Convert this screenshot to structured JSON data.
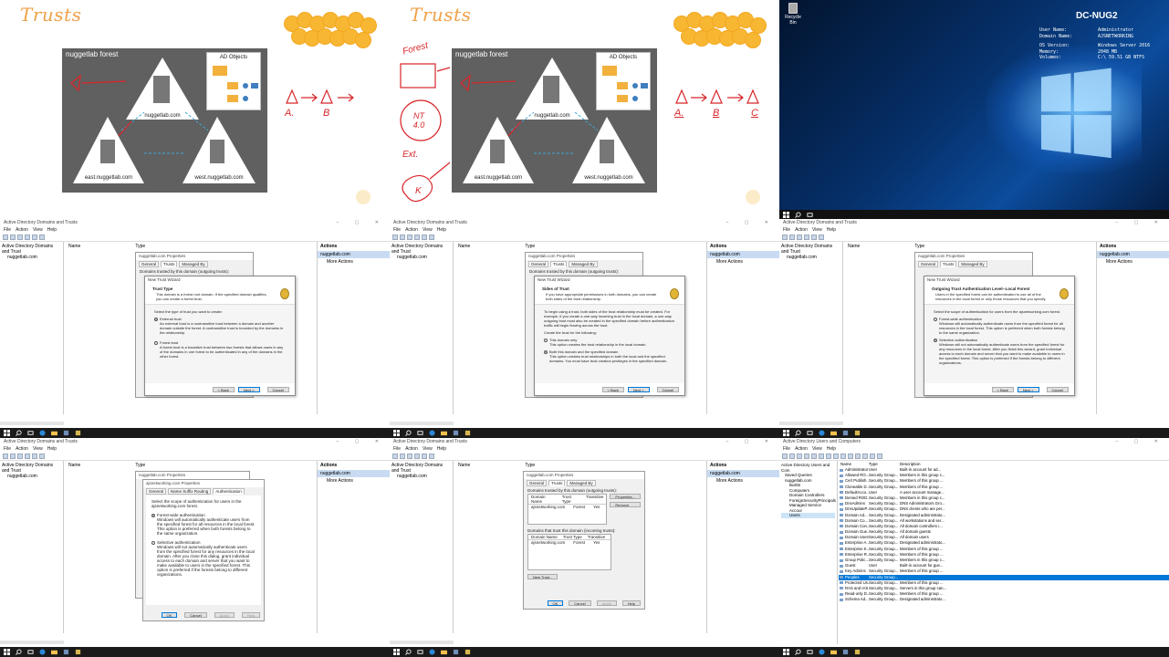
{
  "whiteboard1": {
    "title": "Trusts",
    "forest_label": "nuggetlab forest",
    "ad_objects": "AD Objects",
    "root_domain": "nuggetlab.com",
    "child_east": "east.nuggetlab.com",
    "child_west": "west.nuggetlab.com",
    "notes": {
      "a": "A.",
      "b": "B"
    }
  },
  "whiteboard2": {
    "title": "Trusts",
    "forest_label": "nuggetlab forest",
    "ad_objects": "AD Objects",
    "root_domain": "nuggetlab.com",
    "child_east": "east.nuggetlab.com",
    "child_west": "west.nuggetlab.com",
    "notes": {
      "forest": "Forest",
      "nt": "NT 4.0",
      "ext": "Ext.",
      "k": "K",
      "a": "A.",
      "b": "B",
      "c": "C"
    }
  },
  "desktop": {
    "recycle_bin": "Recycle Bin",
    "hostname": "DC-NUG2",
    "info": [
      {
        "k": "User Name:",
        "v": "Administrator"
      },
      {
        "k": "Domain Name:",
        "v": "AJSNETWORKING"
      },
      {
        "k": "",
        "v": ""
      },
      {
        "k": "OS Version:",
        "v": "Windows Server 2016"
      },
      {
        "k": "Memory:",
        "v": "2048 MB"
      },
      {
        "k": "Volumes:",
        "v": "C:\\ 59.51 GB NTFS"
      }
    ]
  },
  "adtrusts": {
    "window_title": "Active Directory Domains and Trusts",
    "menu": [
      "File",
      "Action",
      "View",
      "Help"
    ],
    "tree_root": "Active Directory Domains and Trust",
    "tree_child": "nuggetlab.com",
    "col_name": "Name",
    "col_type": "Type",
    "actions_title": "Actions",
    "actions_selected": "nuggetlab.com",
    "actions_more": "More Actions",
    "props_title": "nuggetlab.com Properties",
    "props_tabs": [
      "General",
      "Trusts",
      "Managed By"
    ],
    "props_outgoing": "Domains trusted by this domain (outgoing trusts):"
  },
  "wizard1": {
    "title": "New Trust Wizard",
    "heading": "Trust Type",
    "sub": "This domain is a forest root domain. If the specified domain qualifies, you can create a forest trust.",
    "prompt": "Select the type of trust you want to create:",
    "opt1": "External trust",
    "opt1_desc": "An external trust is a nontransitive trust between a domain and another domain outside the forest. A nontransitive trust is bounded by the domains in the relationship.",
    "opt2": "Forest trust",
    "opt2_desc": "A forest trust is a transitive trust between two forests that allows users in any of the domains in one forest to be authenticated in any of the domains in the other forest.",
    "back": "< Back",
    "next": "Next >",
    "cancel": "Cancel"
  },
  "wizard2": {
    "title": "New Trust Wizard",
    "heading": "Sides of Trust",
    "sub": "If you have appropriate permissions in both domains, you can create both sides of the trust relationship.",
    "info": "To begin using a trust, both sides of the trust relationship must be created. For example, if you create a one-way incoming trust in the local domain, a one-way outgoing trust must also be created in the specified domain before authentication traffic will begin flowing across the trust.",
    "prompt": "Create the trust for the following:",
    "opt1": "This domain only",
    "opt1_desc": "This option creates the trust relationship in the local domain.",
    "opt2": "Both this domain and the specified domain",
    "opt2_desc": "This option creates trust relationships in both the local and the specified domains. You must have trust creation privileges in the specified domain.",
    "back": "< Back",
    "next": "Next >",
    "cancel": "Cancel"
  },
  "wizard3": {
    "title": "New Trust Wizard",
    "heading": "Outgoing Trust Authentication Level--Local Forest",
    "sub": "Users in the specified forest can be authenticated to use all of the resources in the local forest or only those resources that you specify.",
    "prompt": "Select the scope of authentication for users from the ajsnetworking.com forest.",
    "opt1": "Forest-wide authentication",
    "opt1_desc": "Windows will automatically authenticate users from the specified forest for all resources in the local forest. This option is preferred when both forests belong to the same organization.",
    "opt2": "Selective authentication",
    "opt2_desc": "Windows will not automatically authenticate users from the specified forest for any resources in the local forest. After you finish this wizard, grant individual access to each domain and server that you want to make available to users in the specified forest. This option is preferred if the forests belong to different organizations.",
    "back": "< Back",
    "next": "Next >",
    "cancel": "Cancel"
  },
  "auth_props": {
    "title": "ajsnetworking.com Properties",
    "tabs": [
      "General",
      "Name Suffix Routing",
      "Authentication"
    ],
    "prompt": "Select the scope of authentication for users in the ajsnetworking.com forest.",
    "opt1": "Forest-wide authentication",
    "opt1_desc": "Windows will automatically authenticate users from the specified forest for all resources in the local forest. This option is preferred when both forests belong to the same organization.",
    "opt2": "Selective authentication",
    "opt2_desc": "Windows will not automatically authenticate users from the specified forest for any resources in the local domain. After you close this dialog, grant individual access to each domain and server that you want to make available to users in the specified forest. This option is preferred if the forests belong to different organizations.",
    "ok": "OK",
    "cancel": "Cancel",
    "apply": "Apply",
    "help": "Help"
  },
  "trusts_props": {
    "title": "nuggetlab.com Properties",
    "tabs": [
      "General",
      "Trusts",
      "Managed By"
    ],
    "outgoing_label": "Domains trusted by this domain (outgoing trusts):",
    "incoming_label": "Domains that trust this domain (incoming trusts):",
    "cols": [
      "Domain Name",
      "Trust Type",
      "Transitive"
    ],
    "out_row": [
      "ajsnetworking.com",
      "Forest",
      "Yes"
    ],
    "in_row": [
      "ajsnetworking.com",
      "Forest",
      "Yes"
    ],
    "properties": "Properties...",
    "remove": "Remove",
    "new_trust": "New Trust...",
    "ok": "OK",
    "cancel": "Cancel",
    "apply": "Apply",
    "help": "Help"
  },
  "aduc": {
    "window_title": "Active Directory Users and Computers",
    "menu": [
      "File",
      "Action",
      "View",
      "Help"
    ],
    "tree": [
      "Active Directory Users and Com",
      "Saved Queries",
      "nuggetlab.com",
      "Builtin",
      "Computers",
      "Domain Controllers",
      "ForeignSecurityPrincipals",
      "Managed Service Accour",
      "Users"
    ],
    "cols": [
      "Name",
      "Type",
      "Description"
    ],
    "rows": [
      [
        "Administrator",
        "User",
        "Built-in account for ad..."
      ],
      [
        "Allowed RO...",
        "Security Group...",
        "Members in this group c..."
      ],
      [
        "Cert Publish...",
        "Security Group...",
        "Members of this group ..."
      ],
      [
        "Cloneable D...",
        "Security Group...",
        "Members of this group ..."
      ],
      [
        "DefaultAcco...",
        "User",
        "A user account manage..."
      ],
      [
        "Denied ROD...",
        "Security Group...",
        "Members in this group c..."
      ],
      [
        "DnsAdmins",
        "Security Group...",
        "DNS Administrators Gro..."
      ],
      [
        "DnsUpdateP...",
        "Security Group...",
        "DNS clients who are per..."
      ],
      [
        "Domain Ad...",
        "Security Group...",
        "Designated administrato..."
      ],
      [
        "Domain Co...",
        "Security Group...",
        "All workstations and ser..."
      ],
      [
        "Domain Con...",
        "Security Group...",
        "All domain controllers i..."
      ],
      [
        "Domain Gue...",
        "Security Group...",
        "All domain guests"
      ],
      [
        "Domain Users",
        "Security Group...",
        "All domain users"
      ],
      [
        "Enterprise A...",
        "Security Group...",
        "Designated administrato..."
      ],
      [
        "Enterprise K...",
        "Security Group...",
        "Members of this group ..."
      ],
      [
        "Enterprise R...",
        "Security Group...",
        "Members of this group ..."
      ],
      [
        "Group Polic...",
        "Security Group...",
        "Members in this group c..."
      ],
      [
        "Guest",
        "User",
        "Built-in account for gue..."
      ],
      [
        "Key Admins",
        "Security Group...",
        "Members of this group ..."
      ],
      [
        "Peoples",
        "Security Group...",
        ""
      ],
      [
        "Protected Us...",
        "Security Group...",
        "Members of this group ..."
      ],
      [
        "RAS and IAS ...",
        "Security Group...",
        "Servers in this group can..."
      ],
      [
        "Read-only D...",
        "Security Group...",
        "Members of this group ..."
      ],
      [
        "Schema Ad...",
        "Security Group...",
        "Designated administrato..."
      ]
    ],
    "selected_index": 19
  },
  "colors": {
    "accent": "#0078d7",
    "whiteboard_title": "#f0a24a",
    "marker_red": "#d8262a",
    "diagram_bg": "#606060"
  }
}
